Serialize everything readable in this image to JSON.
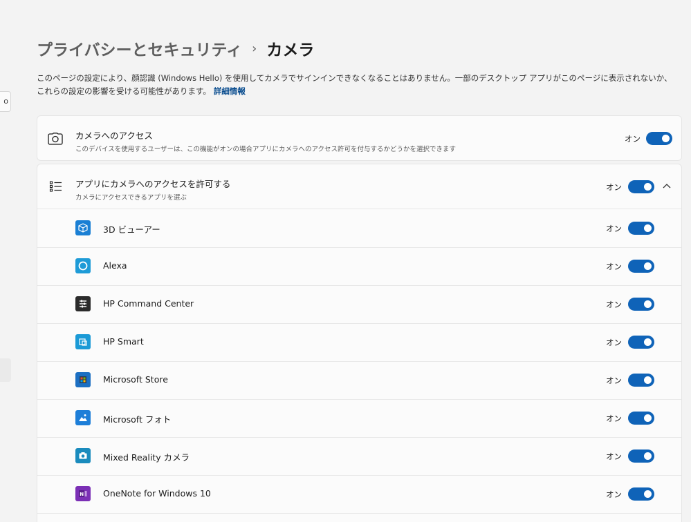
{
  "breadcrumb": {
    "parent": "プライバシーとセキュリティ",
    "separator": "›",
    "current": "カメラ"
  },
  "description": {
    "text": "このページの設定により、顔認識 (Windows Hello) を使用してカメラでサインインできなくなることはありません。一部のデスクトップ アプリがこのページに表示されないか、これらの設定の影響を受ける可能性があります。",
    "link": "詳細情報"
  },
  "left_strip": {
    "fragment": "o"
  },
  "camera_access": {
    "title": "カメラへのアクセス",
    "subtitle": "このデバイスを使用するユーザーは、この機能がオンの場合アプリにカメラへのアクセス許可を付与するかどうかを選択できます",
    "state": "オン",
    "icon": "camera-icon"
  },
  "app_access": {
    "title": "アプリにカメラへのアクセスを許可する",
    "subtitle": "カメラにアクセスできるアプリを選ぶ",
    "state": "オン",
    "icon": "list-icon",
    "expand_icon": "chevron-up-icon"
  },
  "apps": [
    {
      "name": "3D ビューアー",
      "state": "オン",
      "icon": "3d-viewer-icon",
      "color": "#1a7fd4"
    },
    {
      "name": "Alexa",
      "state": "オン",
      "icon": "alexa-icon",
      "color": "#1e9bd7"
    },
    {
      "name": "HP Command Center",
      "state": "オン",
      "icon": "hp-command-center-icon",
      "color": "#2b2b2b"
    },
    {
      "name": "HP Smart",
      "state": "オン",
      "icon": "hp-smart-icon",
      "color": "#1b9ad6"
    },
    {
      "name": "Microsoft Store",
      "state": "オン",
      "icon": "microsoft-store-icon",
      "color": "#1c6fc2"
    },
    {
      "name": "Microsoft フォト",
      "state": "オン",
      "icon": "photos-icon",
      "color": "#1d7ed8"
    },
    {
      "name": "Mixed Reality カメラ",
      "state": "オン",
      "icon": "mixed-reality-camera-icon",
      "color": "#1a8bbd"
    },
    {
      "name": "OneNote for Windows 10",
      "state": "オン",
      "icon": "onenote-icon",
      "color": "#7b2fb5"
    }
  ],
  "colors": {
    "accent": "#0f63b8",
    "background": "#f3f3f3",
    "card": "#fbfbfb"
  }
}
